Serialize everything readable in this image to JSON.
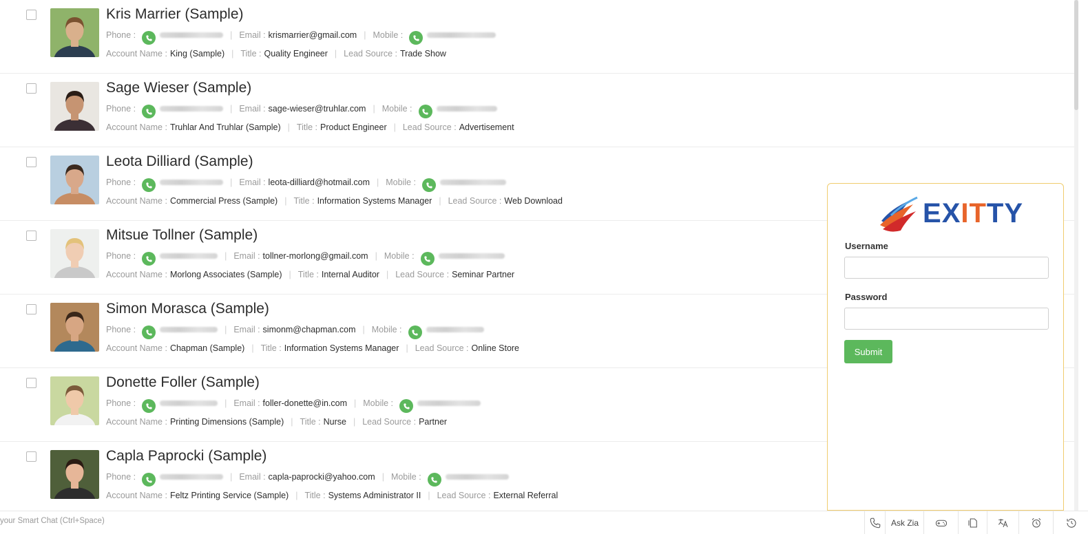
{
  "labels": {
    "phone": "Phone :",
    "email": "Email :",
    "mobile": "Mobile :",
    "account": "Account Name :",
    "title": "Title :",
    "lead": "Lead Source :"
  },
  "contacts": [
    {
      "name": "Kris Marrier (Sample)",
      "email": "krismarrier@gmail.com",
      "account": "King (Sample)",
      "title": "Quality Engineer",
      "lead": "Trade Show",
      "skin": "#d9b08c",
      "shirt": "#2c3e50",
      "hair": "#7a5230",
      "bg": "#8fb36a"
    },
    {
      "name": "Sage Wieser (Sample)",
      "email": "sage-wieser@truhlar.com",
      "account": "Truhlar And Truhlar (Sample)",
      "title": "Product Engineer",
      "lead": "Advertisement",
      "skin": "#c69472",
      "shirt": "#3b2f35",
      "hair": "#2a1d16",
      "bg": "#e9e6e1"
    },
    {
      "name": "Leota Dilliard (Sample)",
      "email": "leota-dilliard@hotmail.com",
      "account": "Commercial Press (Sample)",
      "title": "Information Systems Manager",
      "lead": "Web Download",
      "skin": "#d8a88a",
      "shirt": "#c78d64",
      "hair": "#3b2a1f",
      "bg": "#b9cfe0"
    },
    {
      "name": "Mitsue Tollner (Sample)",
      "email": "tollner-morlong@gmail.com",
      "account": "Morlong Associates (Sample)",
      "title": "Internal Auditor",
      "lead": "Seminar Partner",
      "skin": "#f0cdb3",
      "shirt": "#c9c9c9",
      "hair": "#e3c27a",
      "bg": "#eef0ee"
    },
    {
      "name": "Simon Morasca (Sample)",
      "email": "simonm@chapman.com",
      "account": "Chapman (Sample)",
      "title": "Information Systems Manager",
      "lead": "Online Store",
      "skin": "#d7a683",
      "shirt": "#2e6a8e",
      "hair": "#3a2719",
      "bg": "#b3885c"
    },
    {
      "name": "Donette Foller (Sample)",
      "email": "foller-donette@in.com",
      "account": "Printing Dimensions (Sample)",
      "title": "Nurse",
      "lead": "Partner",
      "skin": "#efc9a9",
      "shirt": "#f2f2f2",
      "hair": "#7b5a3a",
      "bg": "#c9d8a0"
    },
    {
      "name": "Capla Paprocki (Sample)",
      "email": "capla-paprocki@yahoo.com",
      "account": "Feltz Printing Service (Sample)",
      "title": "Systems Administrator II",
      "lead": "External Referral",
      "skin": "#e6b698",
      "shirt": "#2d2d2d",
      "hair": "#2b1b13",
      "bg": "#4f5f3a"
    }
  ],
  "login": {
    "logo_e": "E",
    "logo_x": "X",
    "logo_it": "IT",
    "logo_ty": "TY",
    "username_label": "Username",
    "username_value": "",
    "password_label": "Password",
    "password_value": "",
    "submit_label": "Submit"
  },
  "bottombar": {
    "chat_hint": "your Smart Chat (Ctrl+Space)",
    "ask_zia": "Ask Zia"
  },
  "colors": {
    "call_green": "#5cb85c",
    "panel_border": "#f0cc6e",
    "logo_blue": "#2653a8",
    "logo_orange": "#e8642a"
  }
}
